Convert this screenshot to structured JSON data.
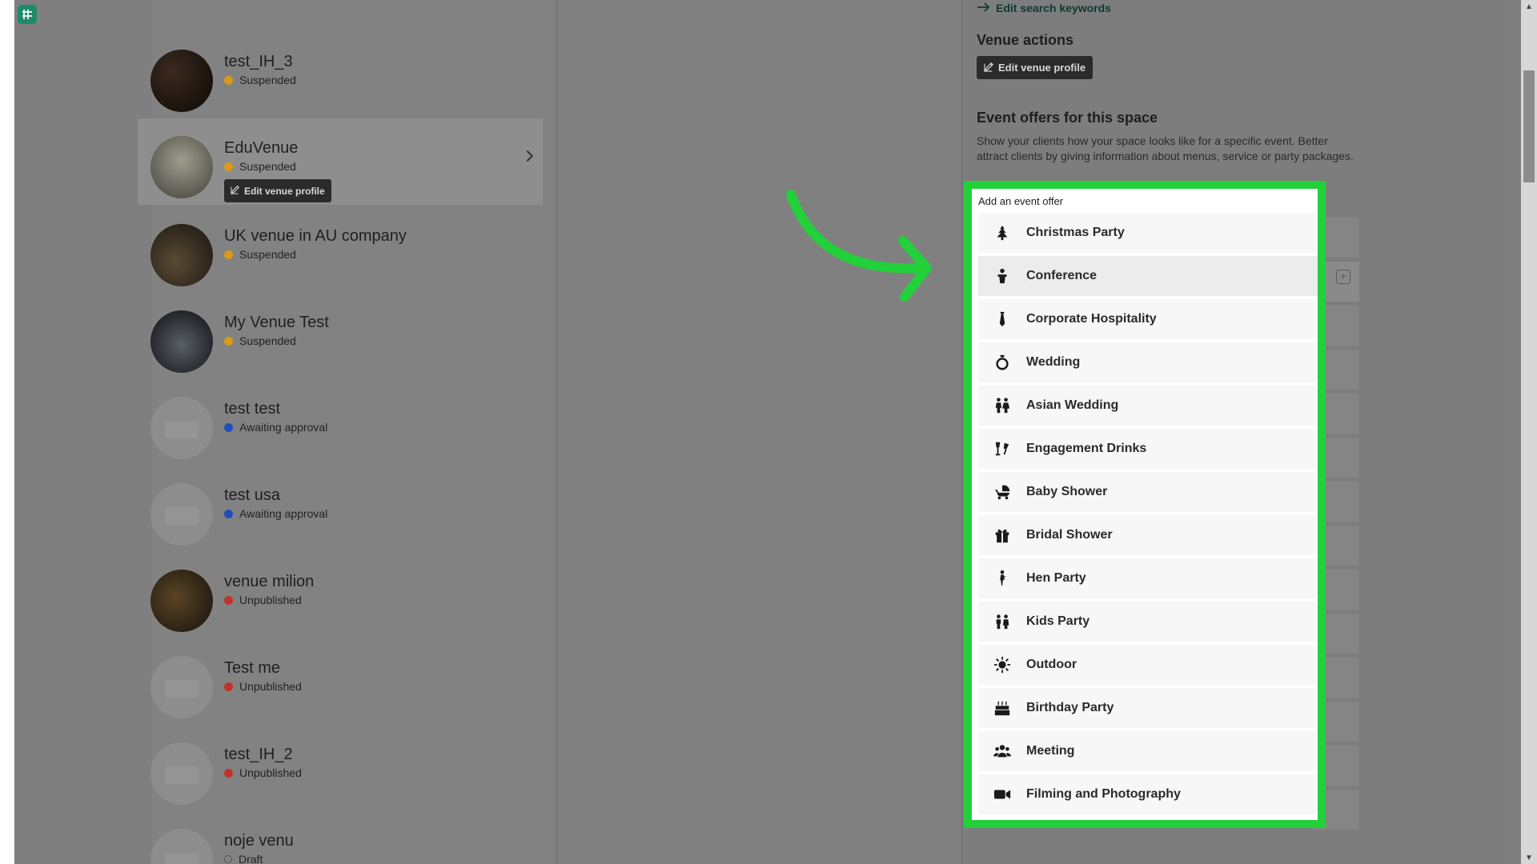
{
  "app": {
    "logo_icon": "app-logo-icon"
  },
  "venues": [
    {
      "name": "",
      "status": "",
      "status_color": "",
      "avatar": "photo"
    },
    {
      "name": "test_IH_3",
      "status": "Suspended",
      "status_color": "#d99a1a",
      "avatar": "photo1"
    },
    {
      "name": "EduVenue",
      "status": "Suspended",
      "status_color": "#d99a1a",
      "avatar": "photo2",
      "selected": true,
      "edit_label": "Edit venue profile"
    },
    {
      "name": "UK venue in AU company",
      "status": "Suspended",
      "status_color": "#d99a1a",
      "avatar": "photo3"
    },
    {
      "name": "My Venue Test",
      "status": "Suspended",
      "status_color": "#d99a1a",
      "avatar": "photo4"
    },
    {
      "name": "test test",
      "status": "Awaiting approval",
      "status_color": "#1f4fb8",
      "avatar": "placeholder"
    },
    {
      "name": "test usa",
      "status": "Awaiting approval",
      "status_color": "#1f4fb8",
      "avatar": "placeholder"
    },
    {
      "name": "venue milion",
      "status": "Unpublished",
      "status_color": "#c0322b",
      "avatar": "photo5"
    },
    {
      "name": "Test me",
      "status": "Unpublished",
      "status_color": "#c0322b",
      "avatar": "placeholder"
    },
    {
      "name": "test_IH_2",
      "status": "Unpublished",
      "status_color": "#c0322b",
      "avatar": "placeholder"
    },
    {
      "name": "noje venu",
      "status": "Draft",
      "status_color": "ring",
      "avatar": "placeholder"
    }
  ],
  "right": {
    "edit_keywords": "Edit search keywords",
    "venue_actions_heading": "Venue actions",
    "edit_venue_profile": "Edit venue profile",
    "event_offers_heading": "Event offers for this space",
    "event_offers_desc": "Show your clients how your space looks like for a specific event. Better attract clients by giving information about menus, service or party packages."
  },
  "popup": {
    "title": "Add an event offer",
    "highlight_color": "#22d13a",
    "offers": [
      {
        "label": "Christmas Party",
        "icon": "christmas-tree-icon"
      },
      {
        "label": "Conference",
        "icon": "conference-speaker-icon"
      },
      {
        "label": "Corporate Hospitality",
        "icon": "tie-icon"
      },
      {
        "label": "Wedding",
        "icon": "ring-icon"
      },
      {
        "label": "Asian Wedding",
        "icon": "couple-icon"
      },
      {
        "label": "Engagement Drinks",
        "icon": "glasses-cheers-icon"
      },
      {
        "label": "Baby Shower",
        "icon": "baby-carriage-icon"
      },
      {
        "label": "Bridal Shower",
        "icon": "gift-icon"
      },
      {
        "label": "Hen Party",
        "icon": "woman-icon"
      },
      {
        "label": "Kids Party",
        "icon": "children-icon"
      },
      {
        "label": "Outdoor",
        "icon": "sun-icon"
      },
      {
        "label": "Birthday Party",
        "icon": "birthday-cake-icon"
      },
      {
        "label": "Meeting",
        "icon": "people-group-icon"
      },
      {
        "label": "Filming and Photography",
        "icon": "video-camera-icon"
      }
    ]
  }
}
